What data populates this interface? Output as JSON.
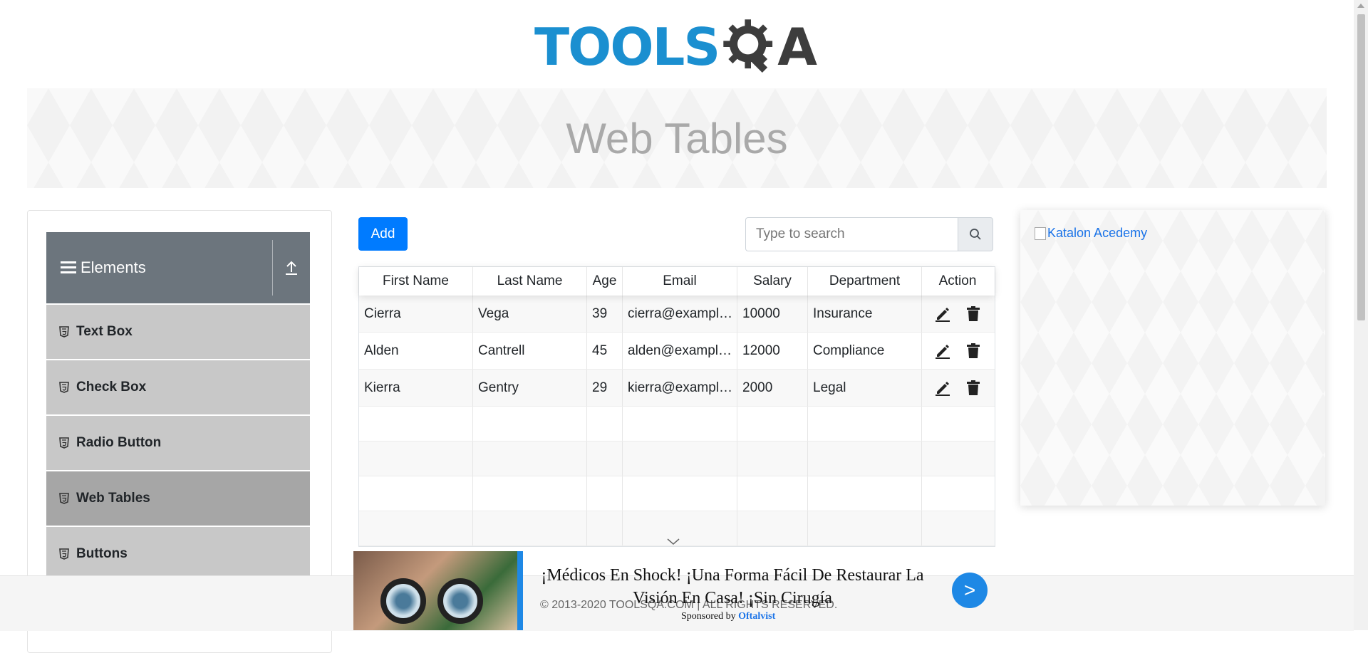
{
  "header": {
    "logo_part1": "TOOLS",
    "logo_part2": "A",
    "page_title": "Web Tables"
  },
  "sidebar": {
    "group_title": "Elements",
    "items": [
      {
        "label": "Text Box",
        "active": false
      },
      {
        "label": "Check Box",
        "active": false
      },
      {
        "label": "Radio Button",
        "active": false
      },
      {
        "label": "Web Tables",
        "active": true
      },
      {
        "label": "Buttons",
        "active": false
      }
    ]
  },
  "toolbar": {
    "add_label": "Add",
    "search_placeholder": "Type to search"
  },
  "table": {
    "columns": [
      "First Name",
      "Last Name",
      "Age",
      "Email",
      "Salary",
      "Department",
      "Action"
    ],
    "rows": [
      [
        "Cierra",
        "Vega",
        "39",
        "cierra@example.com",
        "10000",
        "Insurance"
      ],
      [
        "Alden",
        "Cantrell",
        "45",
        "alden@example.com",
        "12000",
        "Compliance"
      ],
      [
        "Kierra",
        "Gentry",
        "29",
        "kierra@example.com",
        "2000",
        "Legal"
      ]
    ]
  },
  "side_ad": {
    "alt_text": "Katalon Acedemy"
  },
  "footer": {
    "copyright": "© 2013-2020 TOOLSQA.COM | ALL RIGHTS RESERVED."
  },
  "bottom_ad": {
    "headline": "¡Médicos En Shock! ¡Una Forma Fácil De Restaurar La Visión En Casa! ¡Sin Cirugía",
    "sponsored_prefix": "Sponsored by",
    "sponsor_name": "Oftalvist",
    "go_label": ">"
  },
  "colors": {
    "primary": "#007bff",
    "logo_blue": "#1b8fd0",
    "sidebar_header": "#6c757d",
    "menu_item": "#c8c8c8",
    "menu_item_active": "#a6a6a6"
  }
}
